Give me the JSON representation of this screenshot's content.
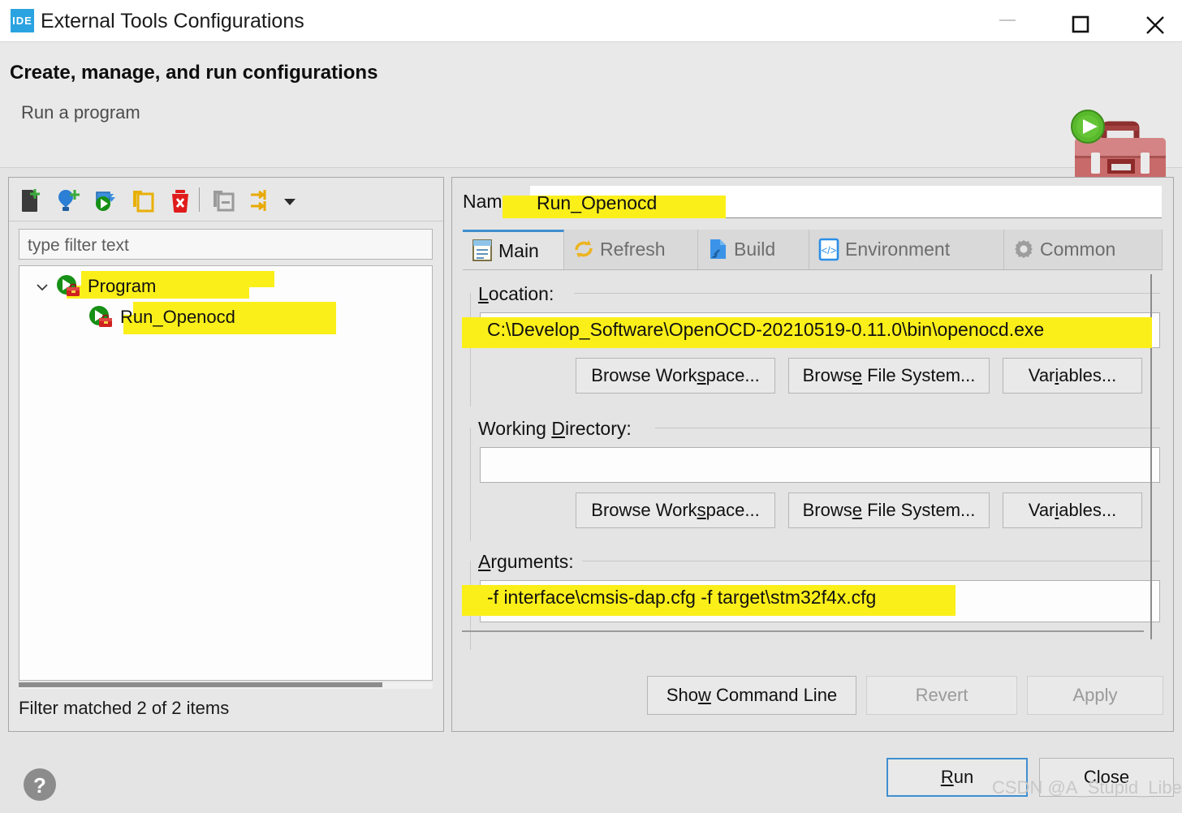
{
  "window": {
    "app_icon": "ide-icon",
    "title": "External Tools Configurations",
    "controls": {
      "minimize": "minimize-icon",
      "maximize": "maximize-icon",
      "close": "close-icon"
    }
  },
  "banner": {
    "title": "Create, manage, and run configurations",
    "subtitle": "Run a program",
    "art": "toolbox-with-run-icon"
  },
  "left_panel": {
    "toolbar": [
      {
        "name": "new-configuration-icon",
        "tooltip": "New launch configuration"
      },
      {
        "name": "new-prototype-icon",
        "tooltip": "New prototype"
      },
      {
        "name": "export-configuration-icon",
        "tooltip": "Export launch configuration"
      },
      {
        "name": "duplicate-icon",
        "tooltip": "Duplicate"
      },
      {
        "name": "delete-icon",
        "tooltip": "Delete"
      },
      {
        "name": "collapse-all-icon",
        "tooltip": "Collapse All"
      },
      {
        "name": "link-prototype-icon",
        "tooltip": "Filter launch configurations"
      },
      {
        "name": "view-menu-chevron-icon",
        "tooltip": "View Menu"
      }
    ],
    "filter": {
      "placeholder": "type filter text",
      "value": ""
    },
    "tree": [
      {
        "label": "Program",
        "icon": "program-run-icon",
        "expanded": true,
        "depth": 0,
        "highlighted": true
      },
      {
        "label": "Run_Openocd",
        "icon": "program-run-icon",
        "expanded": false,
        "depth": 1,
        "highlighted": true,
        "selected": true
      }
    ],
    "status": "Filter matched 2 of 2 items"
  },
  "right_panel": {
    "name": {
      "label": "Name:",
      "value": "Run_Openocd",
      "highlighted": true
    },
    "tabs": [
      {
        "label": "Main",
        "icon": "main-document-icon",
        "active": true
      },
      {
        "label": "Refresh",
        "icon": "refresh-arrows-icon",
        "active": false
      },
      {
        "label": "Build",
        "icon": "build-wrench-page-icon",
        "active": false
      },
      {
        "label": "Environment",
        "icon": "environment-code-icon",
        "active": false
      },
      {
        "label": "Common",
        "icon": "common-gear-icon",
        "active": false
      }
    ],
    "location": {
      "label": "Location:",
      "mnemonic": "L",
      "value": "C:\\Develop_Software\\OpenOCD-20210519-0.11.0\\bin\\openocd.exe",
      "highlighted": true,
      "buttons": [
        {
          "label": "Browse Workspace...",
          "mnemonic": "s",
          "disabled": false
        },
        {
          "label": "Browse File System...",
          "mnemonic": "e",
          "disabled": false
        },
        {
          "label": "Variables...",
          "mnemonic": "i",
          "disabled": false
        }
      ]
    },
    "working_directory": {
      "label": "Working Directory:",
      "mnemonic": "D",
      "value": "",
      "buttons": [
        {
          "label": "Browse Workspace...",
          "mnemonic": "s",
          "disabled": false
        },
        {
          "label": "Browse File System...",
          "mnemonic": "e",
          "disabled": false
        },
        {
          "label": "Variables...",
          "mnemonic": "i",
          "disabled": false
        }
      ]
    },
    "arguments": {
      "label": "Arguments:",
      "mnemonic": "A",
      "value": "-f interface\\cmsis-dap.cfg -f target\\stm32f4x.cfg",
      "highlighted": true
    },
    "actions": [
      {
        "label": "Show Command Line",
        "mnemonic": "w",
        "disabled": false
      },
      {
        "label": "Revert",
        "disabled": true
      },
      {
        "label": "Apply",
        "disabled": true
      }
    ]
  },
  "footer": {
    "help": "help-question-icon",
    "run_button": {
      "label": "Run",
      "mnemonic": "R",
      "focused": true
    },
    "close_button": {
      "label": "Close",
      "disabled": false
    },
    "watermark": "CSDN @A_Stupid_Liberal"
  },
  "colors": {
    "highlight": "#fbef1a",
    "accent": "#3f8fd0",
    "dialog_bg": "#e4e4e4",
    "titlebar_bg": "#ffffff",
    "toolbox_red": "#c14a4a",
    "run_green": "#4eae28",
    "delete_red": "#e01b1b",
    "folder_yellow": "#e8b007"
  }
}
